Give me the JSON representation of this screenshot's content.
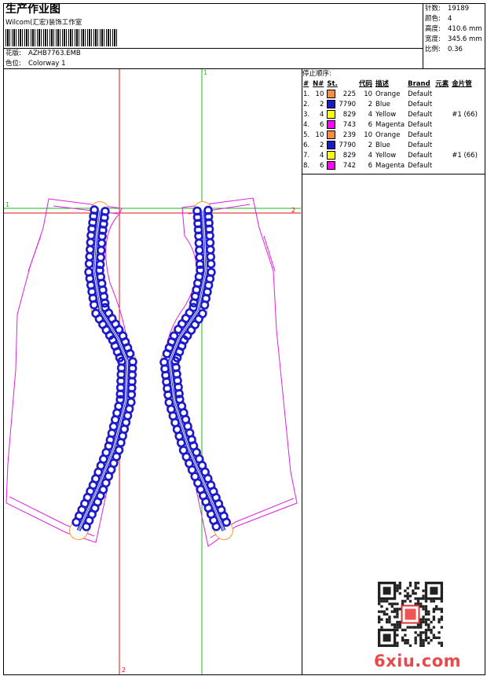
{
  "header": {
    "title": "生产作业图",
    "company": "Wilcom(汇宏)装饰工作室",
    "design_label": "花版:",
    "design_file": "AZHB7763.EMB",
    "colorway_label": "色位:",
    "colorway": "Colorway 1"
  },
  "stats": [
    {
      "label": "针数:",
      "value": "19189"
    },
    {
      "label": "颜色:",
      "value": "4"
    },
    {
      "label": "高度:",
      "value": "410.6 mm"
    },
    {
      "label": "宽度:",
      "value": "345.6 mm"
    },
    {
      "label": "比例:",
      "value": "0.36"
    }
  ],
  "stop_sequence": {
    "title": "停止顺序:",
    "headers": [
      "#",
      "N#",
      "St.",
      "代码",
      "描述",
      "Brand",
      "元素",
      "金片管"
    ],
    "rows": [
      {
        "idx": "1.",
        "n": "10",
        "color": "#FF8C3C",
        "st": "225",
        "code": "10",
        "desc": "Orange",
        "brand": "Default",
        "elem": "",
        "seq": ""
      },
      {
        "idx": "2.",
        "n": "2",
        "color": "#1A1ACC",
        "st": "7790",
        "code": "2",
        "desc": "Blue",
        "brand": "Default",
        "elem": "",
        "seq": ""
      },
      {
        "idx": "3.",
        "n": "4",
        "color": "#FFFF00",
        "st": "829",
        "code": "4",
        "desc": "Yellow",
        "brand": "Default",
        "elem": "",
        "seq": "#1 (66)"
      },
      {
        "idx": "4.",
        "n": "6",
        "color": "#FF00FF",
        "st": "743",
        "code": "6",
        "desc": "Magenta",
        "brand": "Default",
        "elem": "",
        "seq": ""
      },
      {
        "idx": "5.",
        "n": "10",
        "color": "#FF8C3C",
        "st": "239",
        "code": "10",
        "desc": "Orange",
        "brand": "Default",
        "elem": "",
        "seq": ""
      },
      {
        "idx": "6.",
        "n": "2",
        "color": "#1A1ACC",
        "st": "7790",
        "code": "2",
        "desc": "Blue",
        "brand": "Default",
        "elem": "",
        "seq": ""
      },
      {
        "idx": "7.",
        "n": "4",
        "color": "#FFFF00",
        "st": "829",
        "code": "4",
        "desc": "Yellow",
        "brand": "Default",
        "elem": "",
        "seq": "#1 (66)"
      },
      {
        "idx": "8.",
        "n": "6",
        "color": "#FF00FF",
        "st": "742",
        "code": "6",
        "desc": "Magenta",
        "brand": "Default",
        "elem": "",
        "seq": ""
      }
    ]
  },
  "guides": {
    "h1": "1",
    "h2": "2",
    "v1": "1",
    "v2": "2"
  },
  "colors": {
    "outline": "#E020E0",
    "guide_red": "#E01010",
    "guide_green": "#10C010",
    "embroidery_blue": "#1A1ACC",
    "accent_orange": "#FF9933"
  },
  "watermark": {
    "site": "6xiu.com"
  }
}
